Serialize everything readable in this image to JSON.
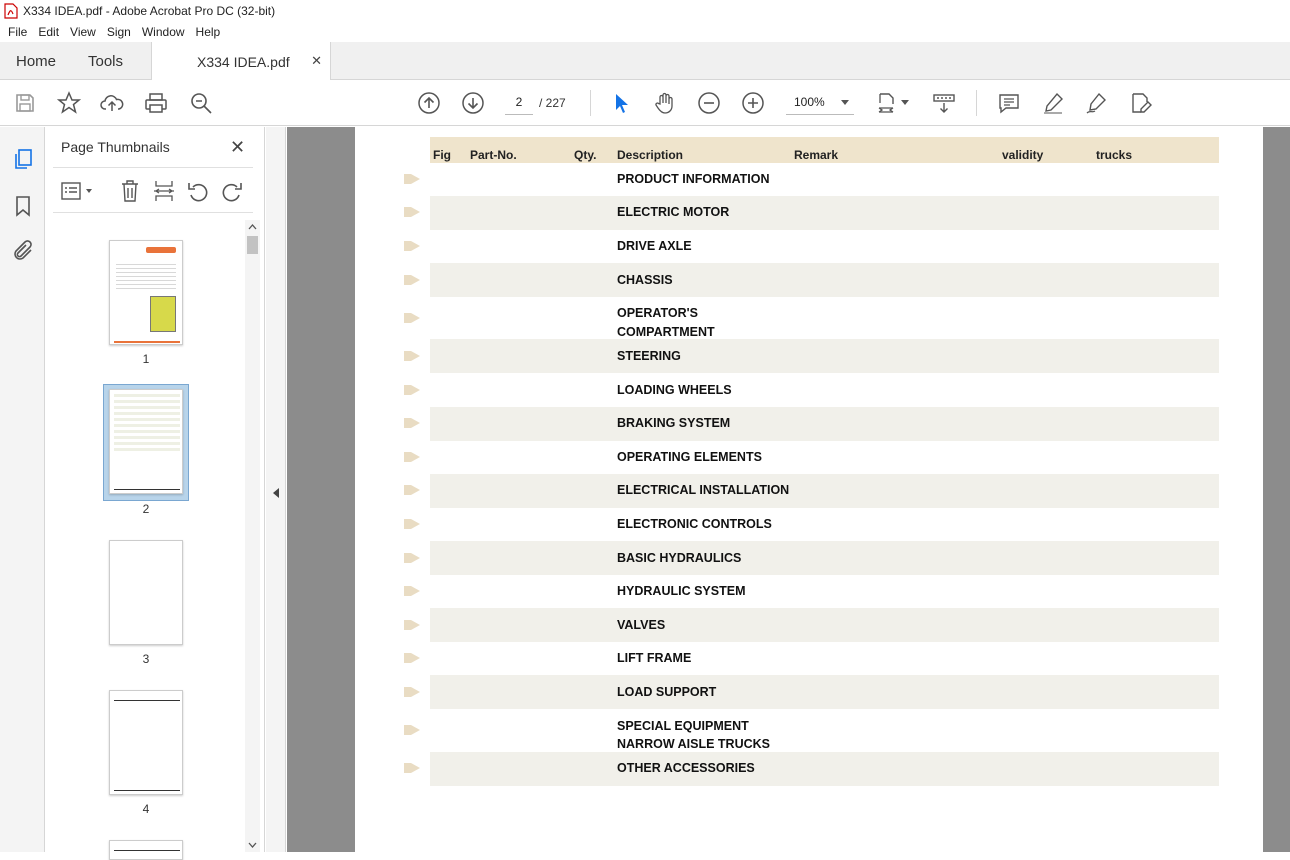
{
  "window": {
    "title": "X334 IDEA.pdf - Adobe Acrobat Pro DC (32-bit)"
  },
  "menu": [
    "File",
    "Edit",
    "View",
    "Sign",
    "Window",
    "Help"
  ],
  "tabs": {
    "home": "Home",
    "tools": "Tools",
    "document": "X334 IDEA.pdf"
  },
  "toolbar": {
    "page_current": "2",
    "page_total": "/ 227",
    "zoom": "100%"
  },
  "thumbnails": {
    "title": "Page Thumbnails",
    "pages": [
      {
        "label": "1"
      },
      {
        "label": "2"
      },
      {
        "label": "3"
      },
      {
        "label": "4"
      }
    ]
  },
  "table": {
    "headers": {
      "fig": "Fig",
      "part_no": "Part-No.",
      "qty": "Qty.",
      "description": "Description",
      "remark": "Remark",
      "validity": "validity",
      "trucks": "trucks"
    },
    "rows": [
      {
        "line1": "PRODUCT INFORMATION",
        "line2": ""
      },
      {
        "line1": "ELECTRIC MOTOR",
        "line2": ""
      },
      {
        "line1": "DRIVE AXLE",
        "line2": ""
      },
      {
        "line1": "CHASSIS",
        "line2": ""
      },
      {
        "line1": "OPERATOR'S",
        "line2": "COMPARTMENT"
      },
      {
        "line1": "STEERING",
        "line2": ""
      },
      {
        "line1": "LOADING WHEELS",
        "line2": ""
      },
      {
        "line1": "BRAKING SYSTEM",
        "line2": ""
      },
      {
        "line1": "OPERATING ELEMENTS",
        "line2": ""
      },
      {
        "line1": "ELECTRICAL INSTALLATION",
        "line2": ""
      },
      {
        "line1": "ELECTRONIC CONTROLS",
        "line2": ""
      },
      {
        "line1": "BASIC HYDRAULICS",
        "line2": ""
      },
      {
        "line1": "HYDRAULIC SYSTEM",
        "line2": ""
      },
      {
        "line1": "VALVES",
        "line2": ""
      },
      {
        "line1": "LIFT FRAME",
        "line2": ""
      },
      {
        "line1": "LOAD SUPPORT",
        "line2": ""
      },
      {
        "line1": "SPECIAL EQUIPMENT",
        "line2": "NARROW AISLE TRUCKS"
      },
      {
        "line1": "OTHER ACCESSORIES",
        "line2": ""
      }
    ]
  },
  "colors": {
    "header_band": "#efe4cc",
    "row_band": "#f1f0ea",
    "accent_blue": "#1473e6",
    "arrow": "#e9dcc3"
  }
}
